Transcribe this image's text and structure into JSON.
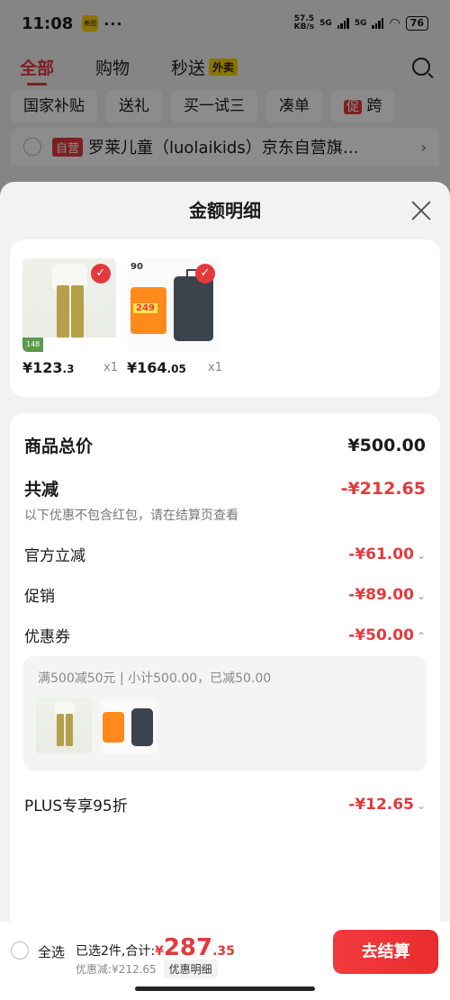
{
  "status": {
    "time": "11:08",
    "app_badge": "美团",
    "dots": "···",
    "net_speed": "57.5",
    "net_unit": "KB/s",
    "sig1": "5G",
    "sig2": "5G",
    "battery": "76"
  },
  "nav": {
    "tabs": [
      "全部",
      "购物",
      "秒送"
    ],
    "flash_badge": "外卖"
  },
  "chips": [
    "国家补贴",
    "送礼",
    "买一试三",
    "凑单",
    "跨"
  ],
  "chip_promo": "促",
  "store": {
    "tag": "自营",
    "name": "罗莱儿童（luolaikids）京东自营旗…"
  },
  "sheet": {
    "title": "金额明细"
  },
  "products": [
    {
      "price_int": "¥123",
      "price_dec": ".3",
      "qty": "x1",
      "tag": "148"
    },
    {
      "price_int": "¥164",
      "price_dec": ".05",
      "qty": "x1",
      "promo": "249"
    }
  ],
  "details": {
    "total_label": "商品总价",
    "total_value": "¥500.00",
    "reduce_label": "共减",
    "reduce_value": "-¥212.65",
    "reduce_note": "以下优惠不包含红包，请在结算页查看",
    "items": [
      {
        "label": "官方立减",
        "value": "-¥61.00",
        "arrow": "⌄"
      },
      {
        "label": "促销",
        "value": "-¥89.00",
        "arrow": "⌄"
      },
      {
        "label": "优惠券",
        "value": "-¥50.00",
        "arrow": "⌃"
      }
    ],
    "coupon_text": "满500减50元 | 小计500.00，已减50.00",
    "plus_label": "PLUS专享95折",
    "plus_value": "-¥12.65",
    "plus_arrow": "⌄"
  },
  "bottom": {
    "select_all": "全选",
    "selected_text": "已选2件,合计:",
    "currency": "¥",
    "total_int": "287",
    "total_dec": ".35",
    "discount_text": "优惠减:¥212.65",
    "detail_pill": "优惠明细",
    "checkout": "去结算"
  },
  "colors": {
    "accent": "#e4393c",
    "checkout_start": "#f23a3c",
    "checkout_end": "#e92d2f"
  }
}
